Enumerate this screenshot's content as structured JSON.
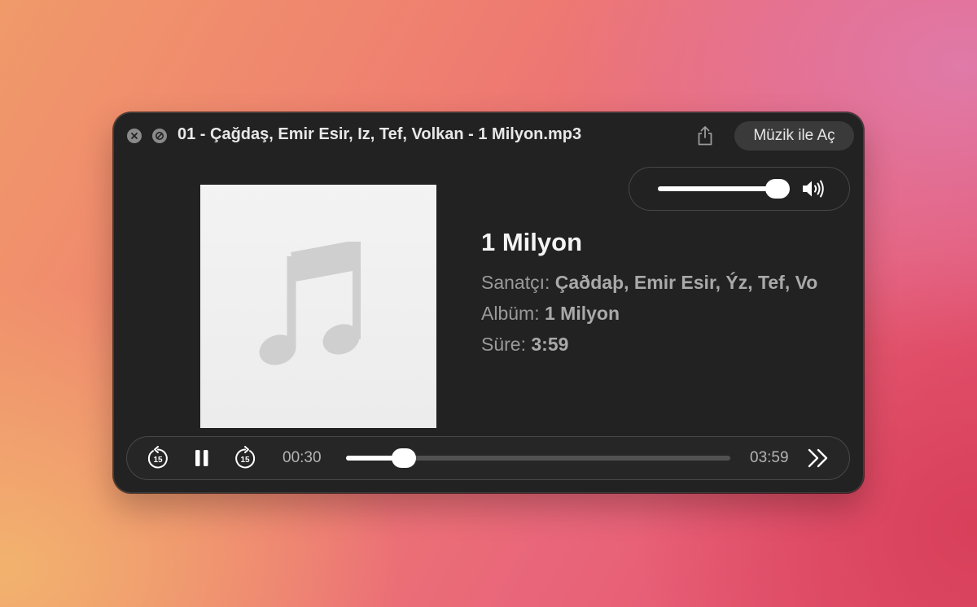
{
  "window": {
    "title": "01 - Çağdaş, Emir Esir, Iz, Tef, Volkan - 1 Milyon.mp3",
    "open_button_label": "Müzik ile Aç"
  },
  "icons": {
    "close": "close-icon",
    "minimize": "minimize-icon",
    "share": "share-icon",
    "speaker": "speaker-icon",
    "artwork": "music-note-icon",
    "skip_back": "skip-back-15-icon",
    "pause": "pause-icon",
    "skip_forward": "skip-forward-15-icon",
    "fast_forward": "fast-forward-icon"
  },
  "volume": {
    "level": 0.92
  },
  "track": {
    "title": "1 Milyon",
    "artist_label": "Sanatçı:",
    "artist_value": "Çaðdaþ, Emir Esir, Ýz, Tef, Vo",
    "album_label": "Albüm:",
    "album_value": "1 Milyon",
    "duration_label": "Süre:",
    "duration_value": "3:59"
  },
  "playback": {
    "current_time": "00:30",
    "total_time": "03:59",
    "progress": 0.15,
    "skip_back_seconds": "15",
    "skip_forward_seconds": "15"
  }
}
